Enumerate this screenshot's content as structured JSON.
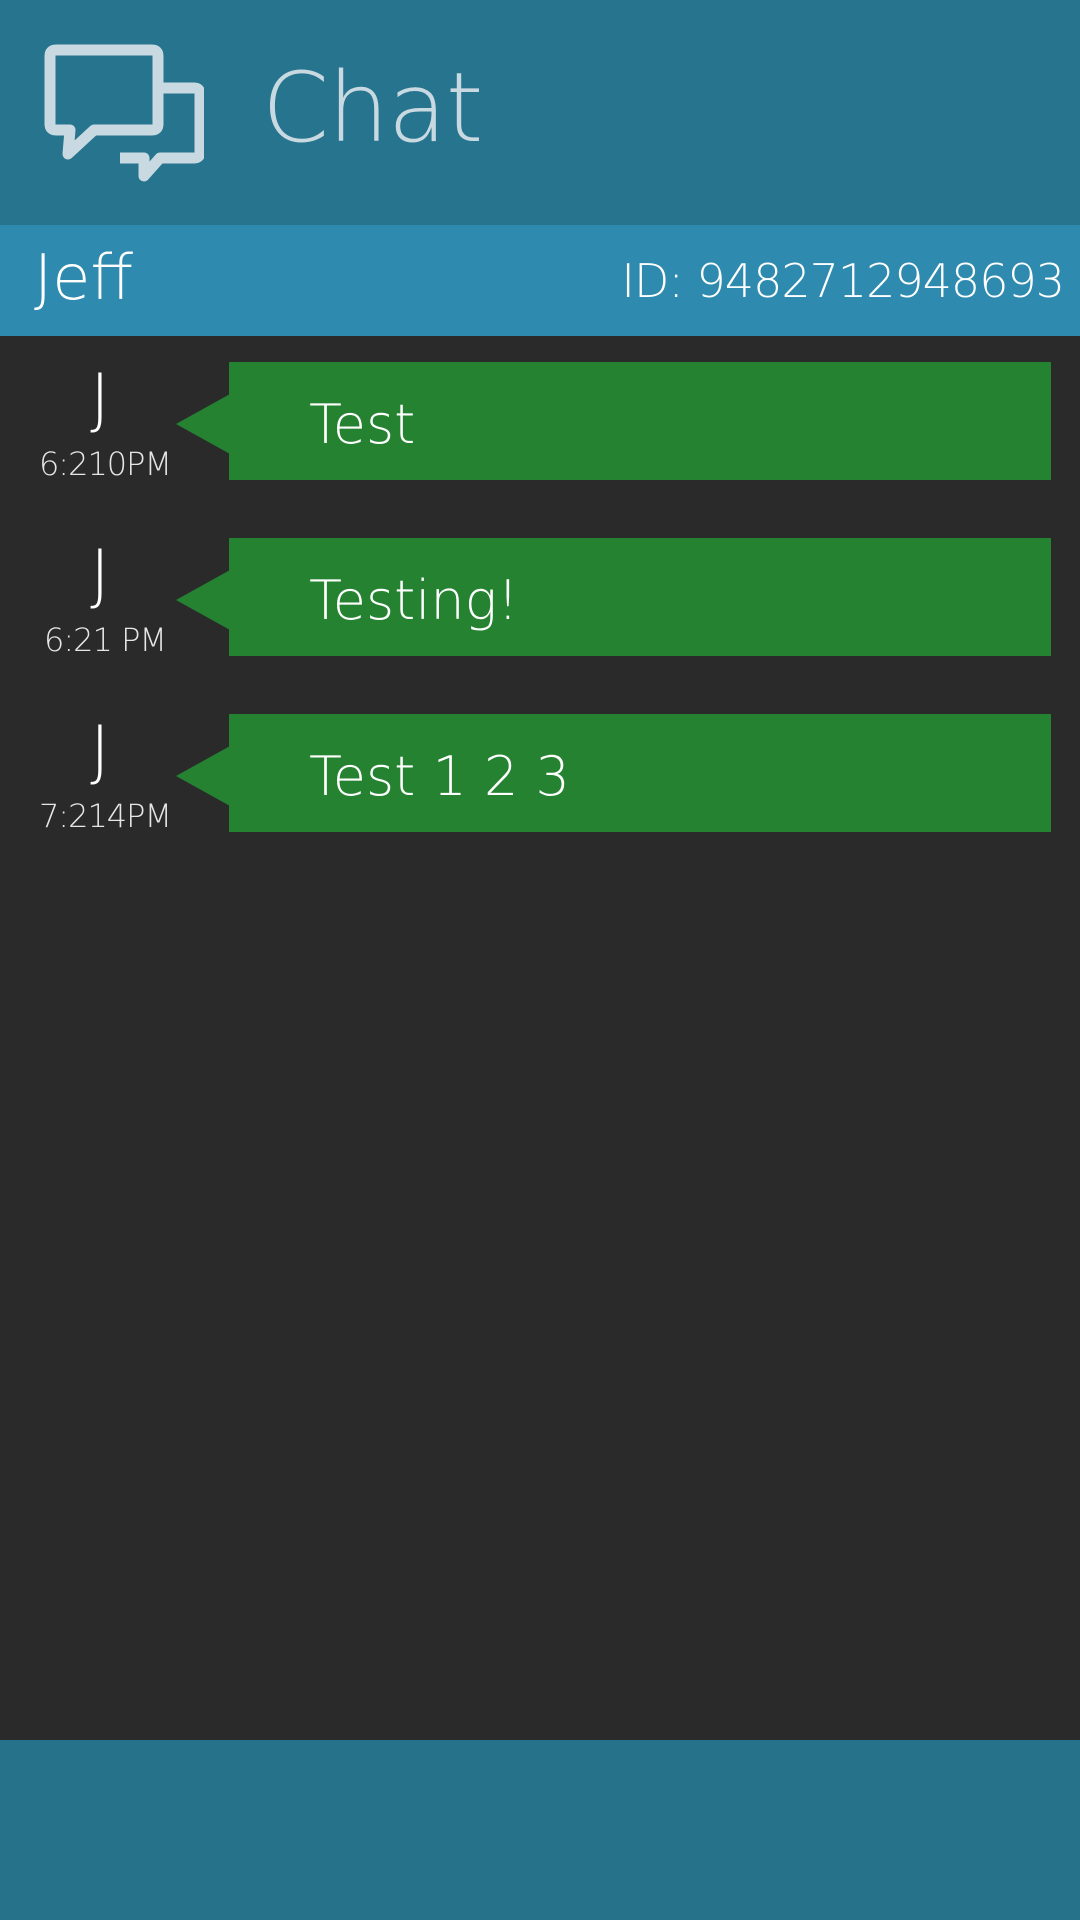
{
  "header": {
    "title": "Chat",
    "icon": "chat-bubbles-icon",
    "background_color": "#26748d"
  },
  "contact": {
    "name": "Jeff",
    "id_label": "ID: 9482712948693",
    "background_color": "#2e8aae"
  },
  "messages": [
    {
      "avatar": "J",
      "time": "6:210PM",
      "text": "Test"
    },
    {
      "avatar": "J",
      "time": "6:21 PM",
      "text": "Testing!"
    },
    {
      "avatar": "J",
      "time": "7:214PM",
      "text": "Test 1 2 3"
    }
  ],
  "colors": {
    "bubble": "#248231",
    "background": "#2a2a2a",
    "footer": "#26728b"
  }
}
